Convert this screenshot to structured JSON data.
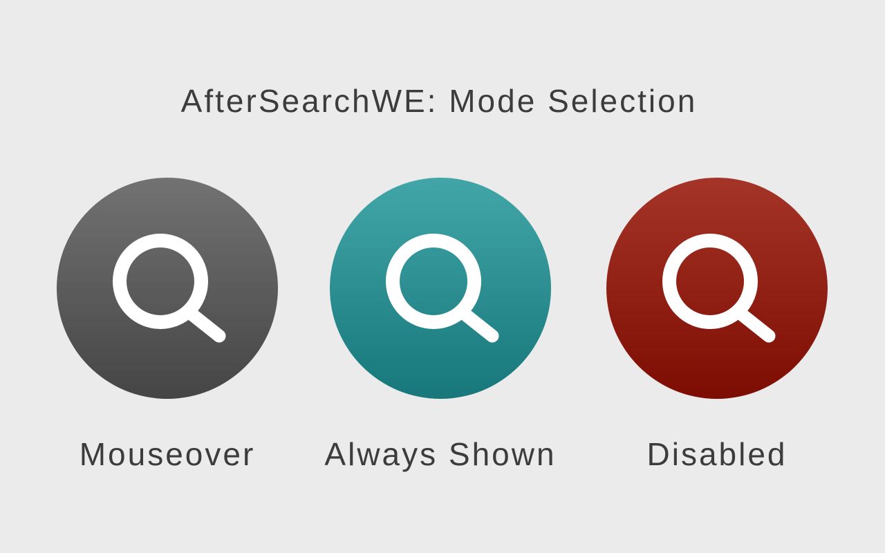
{
  "title": "AfterSearchWE: Mode Selection",
  "modes": [
    {
      "label": "Mouseover",
      "icon": "search-icon",
      "color_top": "#717271",
      "color_bottom": "#444544"
    },
    {
      "label": "Always Shown",
      "icon": "search-icon",
      "color_top": "#42a6a8",
      "color_bottom": "#17777a"
    },
    {
      "label": "Disabled",
      "icon": "search-icon",
      "color_top": "#a53428",
      "color_bottom": "#7d0c02"
    }
  ],
  "colors": {
    "background": "#ebebeb",
    "text": "#3c3c3c",
    "icon": "#ffffff"
  }
}
